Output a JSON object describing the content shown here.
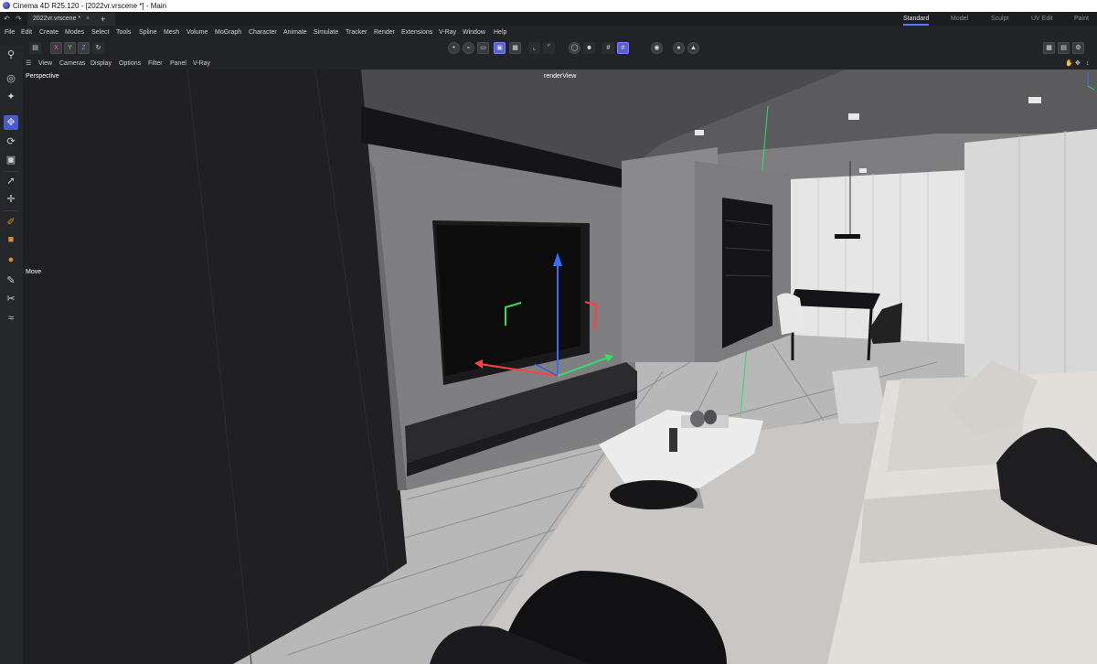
{
  "window": {
    "title": "Cinema 4D R25.120 - [2022vr.vrscene *] - Main"
  },
  "tabs": {
    "document": "2022vr.vrscene *",
    "close_glyph": "×",
    "add_glyph": "+",
    "layouts": [
      "Standard",
      "Model",
      "Sculpt",
      "UV Edit",
      "Paint"
    ],
    "active_layout": "Standard"
  },
  "menubar": [
    "File",
    "Edit",
    "Create",
    "Modes",
    "Select",
    "Tools",
    "Spline",
    "Mesh",
    "Volume",
    "MoGraph",
    "Character",
    "Animate",
    "Simulate",
    "Tracker",
    "Render",
    "Extensions",
    "V-Ray",
    "Window",
    "Help"
  ],
  "toolbar": {
    "axis_x": "X",
    "axis_y": "Y",
    "axis_z": "Z"
  },
  "viewport_menu": [
    "View",
    "Cameras",
    "Display",
    "Options",
    "Filter",
    "Panel",
    "V-Ray"
  ],
  "viewport": {
    "projection": "Perspective",
    "camera_name": "renderView",
    "tool_hint": "Move"
  },
  "icons": {
    "undo": "undo-icon",
    "redo": "redo-icon",
    "search": "search-icon",
    "move": "move-icon",
    "rotate": "rotate-icon",
    "scale": "scale-icon"
  },
  "colors": {
    "accent": "#5a78ff",
    "axis_x": "#ff4040",
    "axis_y": "#33dd66",
    "axis_z": "#3a6bff"
  }
}
